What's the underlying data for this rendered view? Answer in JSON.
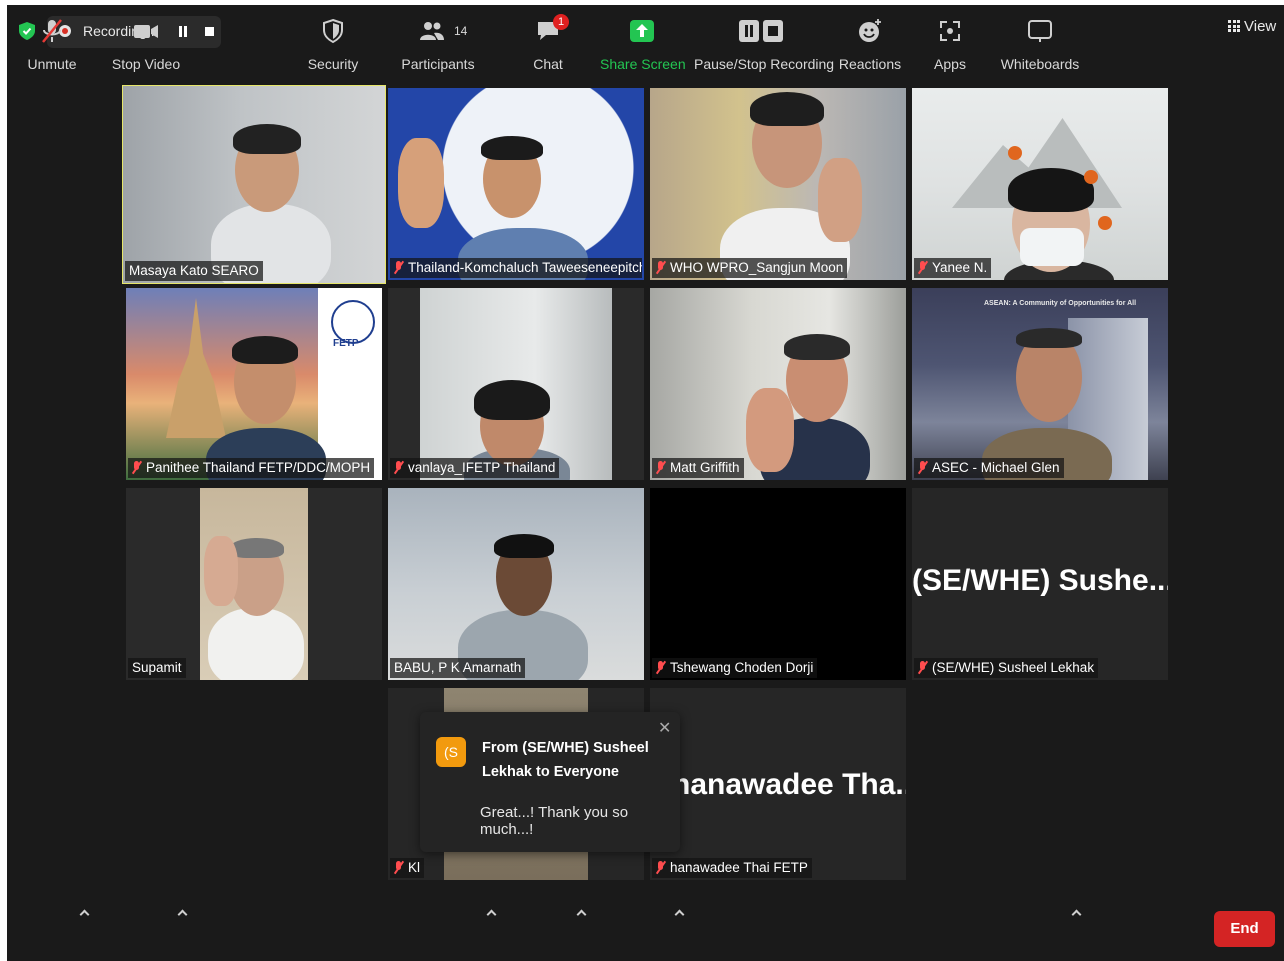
{
  "top_bar": {
    "recording_text": "Recording...",
    "view_label": "View"
  },
  "tiles": [
    {
      "name": "Masaya Kato SEARO",
      "muted": false
    },
    {
      "name": "Thailand-Komchaluch Taweeseneepitch...",
      "muted": true
    },
    {
      "name": "WHO WPRO_Sangjun Moon",
      "muted": true
    },
    {
      "name": "Yanee N.",
      "muted": true
    },
    {
      "name": "Panithee Thailand FETP/DDC/MOPH",
      "muted": true
    },
    {
      "name": "vanlaya_IFETP Thailand",
      "muted": true
    },
    {
      "name": "Matt Griffith",
      "muted": true
    },
    {
      "name": "ASEC - Michael Glen",
      "muted": true
    },
    {
      "name": "Supamit",
      "muted": false
    },
    {
      "name": "BABU, P K Amarnath",
      "muted": false
    },
    {
      "name": "Tshewang Choden Dorji",
      "muted": true
    },
    {
      "name": "(SE/WHE) Susheel Lekhak",
      "muted": true,
      "display_text": "(SE/WHE) Sushe..."
    },
    {
      "name": "Kl",
      "muted": true
    },
    {
      "name": "hanawadee Thai FETP",
      "muted": true,
      "display_text": "hanawadee Tha..."
    }
  ],
  "slide_text": {
    "fetp_logo": "FETP",
    "asean_banner": "ASEAN: A Community of Opportunities for All"
  },
  "chat_popup": {
    "avatar_initials": "(S",
    "from": "From (SE/WHE) Susheel Lekhak to Everyone",
    "message": "Great...! Thank you so much...!"
  },
  "toolbar": {
    "unmute": "Unmute",
    "stop_video": "Stop Video",
    "security": "Security",
    "participants": "Participants",
    "participants_count": "14",
    "chat": "Chat",
    "chat_badge": "1",
    "share_screen": "Share Screen",
    "pause_stop_recording": "Pause/Stop Recording",
    "reactions": "Reactions",
    "apps": "Apps",
    "whiteboards": "Whiteboards",
    "end": "End"
  },
  "colors": {
    "background": "#1a1a1a",
    "active_speaker_border": "#e6e66a",
    "share_screen_green": "#23c552",
    "end_red": "#d42424",
    "muted_red": "#ff4d4f",
    "chat_avatar": "#f29a0e"
  }
}
